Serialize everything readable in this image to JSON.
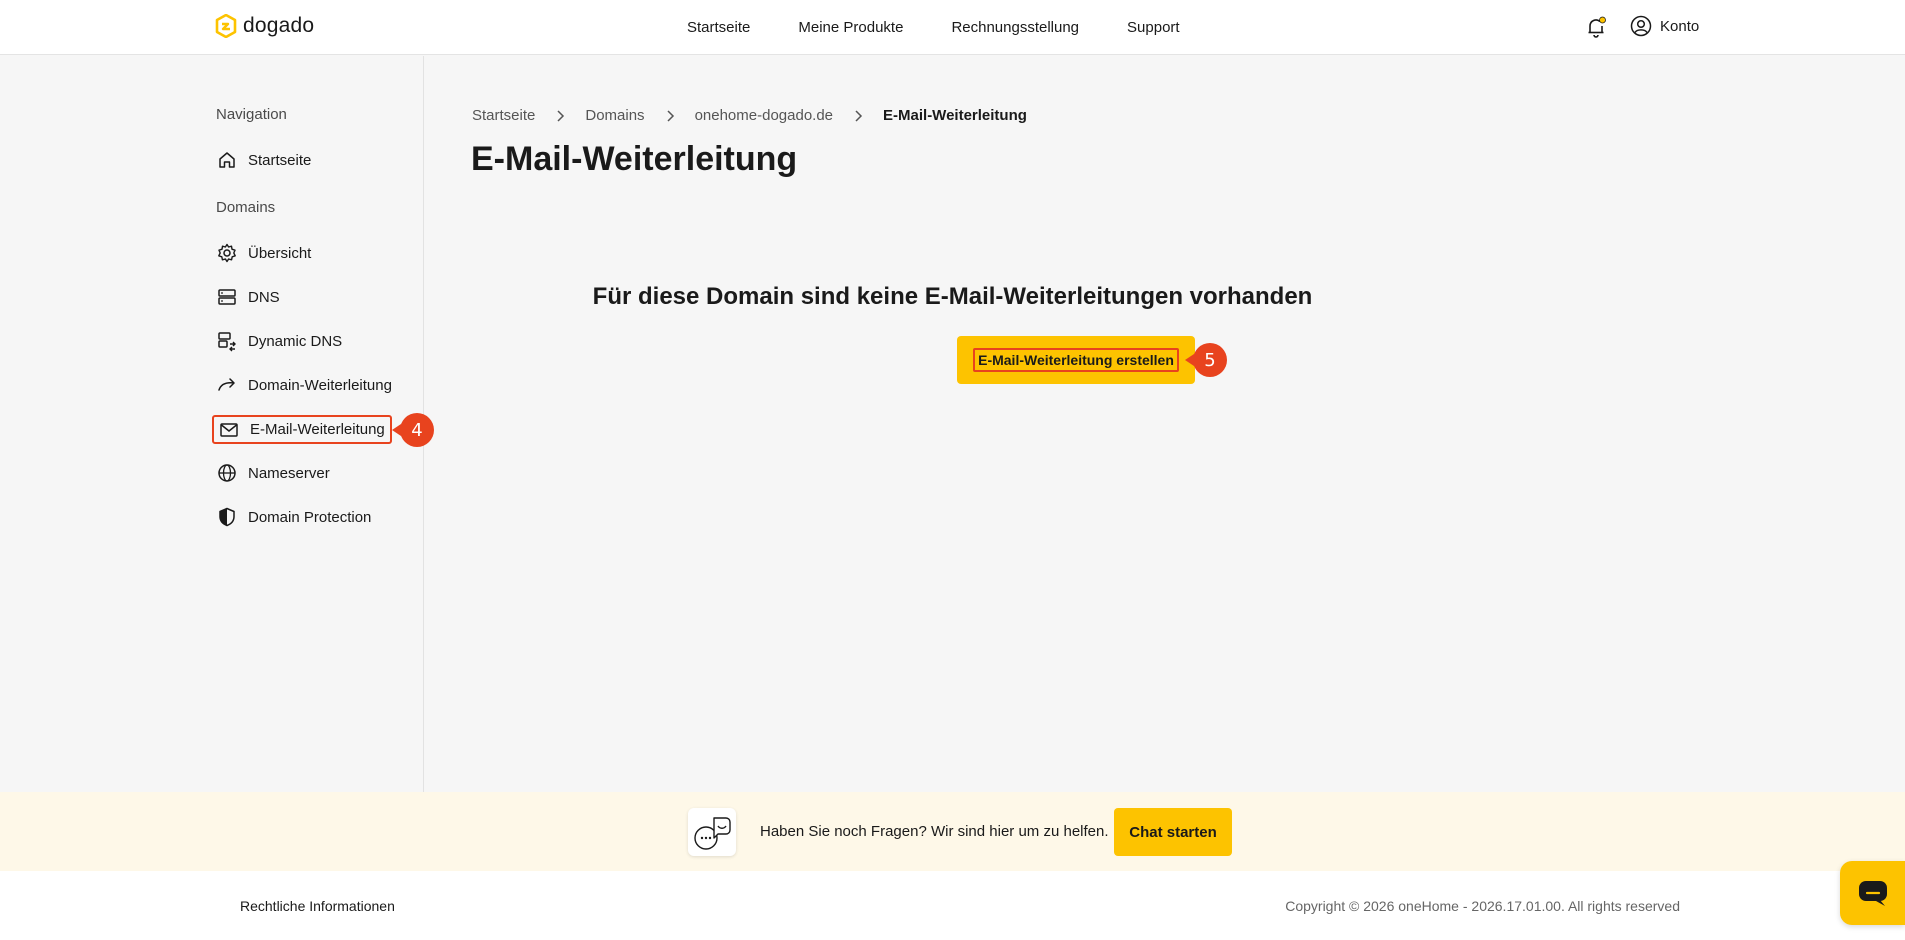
{
  "brand": {
    "name": "dogado",
    "accent": "#fdc300",
    "highlight": "#e8431e"
  },
  "topnav": [
    "Startseite",
    "Meine Produkte",
    "Rechnungsstellung",
    "Support"
  ],
  "account_label": "Konto",
  "sidebar": {
    "nav_heading": "Navigation",
    "home_label": "Startseite",
    "domains_heading": "Domains",
    "items": [
      {
        "label": "Übersicht",
        "icon": "gear-icon"
      },
      {
        "label": "DNS",
        "icon": "server-icon"
      },
      {
        "label": "Dynamic DNS",
        "icon": "dynamic-dns-icon"
      },
      {
        "label": "Domain-Weiterleitung",
        "icon": "forward-arrow-icon"
      },
      {
        "label": "E-Mail-Weiterleitung",
        "icon": "mail-icon",
        "active": true
      },
      {
        "label": "Nameserver",
        "icon": "globe-icon"
      },
      {
        "label": "Domain Protection",
        "icon": "shield-icon"
      }
    ]
  },
  "markers": {
    "sidebar": "4",
    "cta": "5"
  },
  "breadcrumb": [
    "Startseite",
    "Domains",
    "onehome-dogado.de",
    "E-Mail-Weiterleitung"
  ],
  "page_title": "E-Mail-Weiterleitung",
  "empty_state": {
    "title": "Für diese Domain sind keine E-Mail-Weiterleitungen vorhanden",
    "cta_label": "E-Mail-Weiterleitung erstellen"
  },
  "help": {
    "text": "Haben Sie noch Fragen? Wir sind hier um zu helfen.",
    "button": "Chat starten"
  },
  "footer": {
    "legal": "Rechtliche Informationen",
    "copyright": "Copyright © 2026 oneHome - 2026.17.01.00. All rights reserved"
  }
}
